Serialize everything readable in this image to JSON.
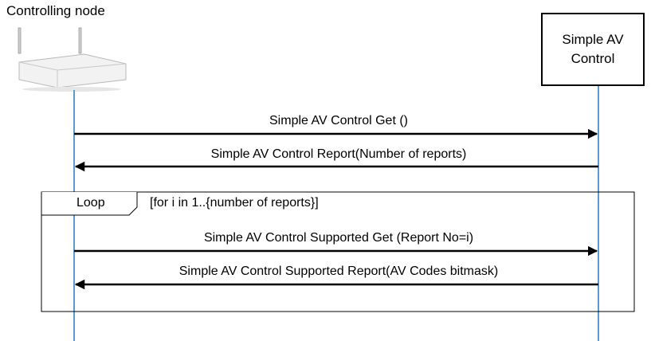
{
  "participants": {
    "left": {
      "label": "Controlling node",
      "icon": "router-icon"
    },
    "right": {
      "label": "Simple AV\nControl"
    }
  },
  "messages": [
    {
      "label": "Simple AV Control Get ()",
      "direction": "right"
    },
    {
      "label": "Simple AV Control Report(Number of reports)",
      "direction": "left"
    },
    {
      "label": "Simple AV Control Supported Get (Report No=i)",
      "direction": "right"
    },
    {
      "label": "Simple AV Control Supported Report(AV Codes bitmask)",
      "direction": "left"
    }
  ],
  "loop": {
    "label": "Loop",
    "guard": "[for i in 1..{number of reports}]"
  },
  "colors": {
    "lifeline": "#5b9bd5",
    "arrow": "#000000"
  }
}
